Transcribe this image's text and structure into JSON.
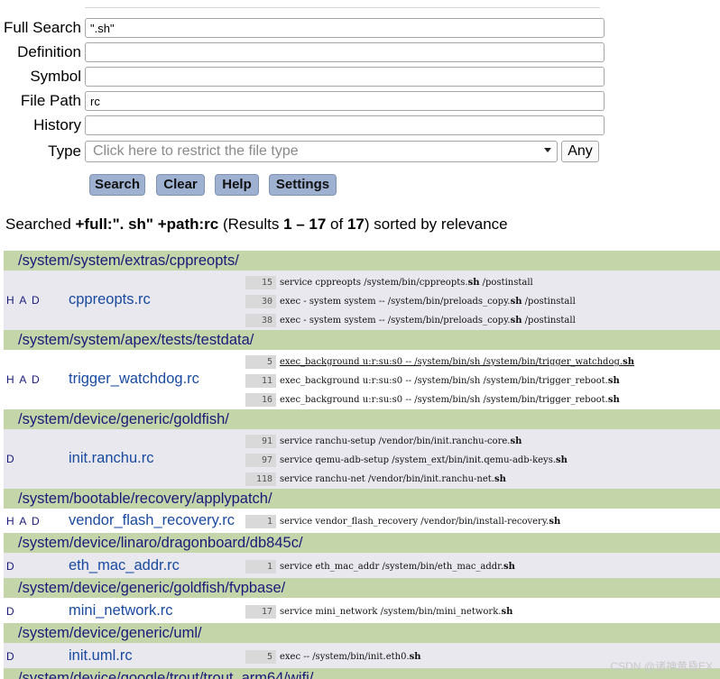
{
  "search_form": {
    "full_search": {
      "label": "Full Search",
      "value": "\".sh\""
    },
    "definition": {
      "label": "Definition",
      "value": ""
    },
    "symbol": {
      "label": "Symbol",
      "value": ""
    },
    "file_path": {
      "label": "File Path",
      "value": "rc"
    },
    "history": {
      "label": "History",
      "value": ""
    },
    "type": {
      "label": "Type",
      "placeholder": "Click here to restrict the file type",
      "any_label": "Any"
    }
  },
  "buttons": {
    "search": "Search",
    "clear": "Clear",
    "help": "Help",
    "settings": "Settings"
  },
  "summary": {
    "prefix": "Searched ",
    "query": "+full:\". sh\" +path:rc",
    "results_open": " (Results ",
    "range": "1 – 17",
    "of": " of ",
    "total": "17",
    "suffix": ") sorted by relevance"
  },
  "results": [
    {
      "dir": "/system/system/extras/cppreopts/",
      "files": [
        {
          "tags": "H A D",
          "name": "cppreopts.rc",
          "lines": [
            {
              "num": "15",
              "pre": "service cppreopts /system/bin/cppreopts.",
              "hl": "sh",
              "post": " /postinstall"
            },
            {
              "num": "30",
              "pre": "exec - system system -- /system/bin/preloads_copy.",
              "hl": "sh",
              "post": " /postinstall"
            },
            {
              "num": "38",
              "pre": "exec - system system -- /system/bin/preloads_copy.",
              "hl": "sh",
              "post": " /postinstall"
            }
          ]
        }
      ]
    },
    {
      "dir": "/system/system/apex/tests/testdata/",
      "files": [
        {
          "tags": "H A D",
          "name": "trigger_watchdog.rc",
          "lines": [
            {
              "num": "5",
              "pre": "exec_background u:r:su:s0 -- /system/bin/sh /system/bin/trigger_watchdog.",
              "hl": "sh",
              "post": ""
            },
            {
              "num": "11",
              "pre": "exec_background u:r:su:s0 -- /system/bin/sh /system/bin/trigger_reboot.",
              "hl": "sh",
              "post": ""
            },
            {
              "num": "16",
              "pre": "exec_background u:r:su:s0 -- /system/bin/sh /system/bin/trigger_reboot.",
              "hl": "sh",
              "post": ""
            }
          ]
        }
      ]
    },
    {
      "dir": "/system/device/generic/goldfish/",
      "files": [
        {
          "tags": "D",
          "name": "init.ranchu.rc",
          "lines": [
            {
              "num": "91",
              "pre": "service ranchu-setup /vendor/bin/init.ranchu-core.",
              "hl": "sh",
              "post": ""
            },
            {
              "num": "97",
              "pre": "service qemu-adb-setup /system_ext/bin/init.qemu-adb-keys.",
              "hl": "sh",
              "post": ""
            },
            {
              "num": "118",
              "pre": "service ranchu-net /vendor/bin/init.ranchu-net.",
              "hl": "sh",
              "post": ""
            }
          ]
        }
      ]
    },
    {
      "dir": "/system/bootable/recovery/applypatch/",
      "files": [
        {
          "tags": "H A D",
          "name": "vendor_flash_recovery.rc",
          "lines": [
            {
              "num": "1",
              "pre": "service vendor_flash_recovery /vendor/bin/install-recovery.",
              "hl": "sh",
              "post": ""
            }
          ]
        }
      ]
    },
    {
      "dir": "/system/device/linaro/dragonboard/db845c/",
      "files": [
        {
          "tags": "D",
          "name": "eth_mac_addr.rc",
          "lines": [
            {
              "num": "1",
              "pre": "service eth_mac_addr /system/bin/eth_mac_addr.",
              "hl": "sh",
              "post": ""
            }
          ]
        }
      ]
    },
    {
      "dir": "/system/device/generic/goldfish/fvpbase/",
      "files": [
        {
          "tags": "D",
          "name": "mini_network.rc",
          "lines": [
            {
              "num": "17",
              "pre": "service mini_network /system/bin/mini_network.",
              "hl": "sh",
              "post": ""
            }
          ]
        }
      ]
    },
    {
      "dir": "/system/device/generic/uml/",
      "files": [
        {
          "tags": "D",
          "name": "init.uml.rc",
          "lines": [
            {
              "num": "5",
              "pre": "exec -- /system/bin/init.eth0.",
              "hl": "sh",
              "post": ""
            }
          ]
        }
      ]
    },
    {
      "dir": "/system/device/google/trout/trout_arm64/wifi/",
      "files": []
    }
  ],
  "watermark": "CSDN @诸神黄昏EX"
}
